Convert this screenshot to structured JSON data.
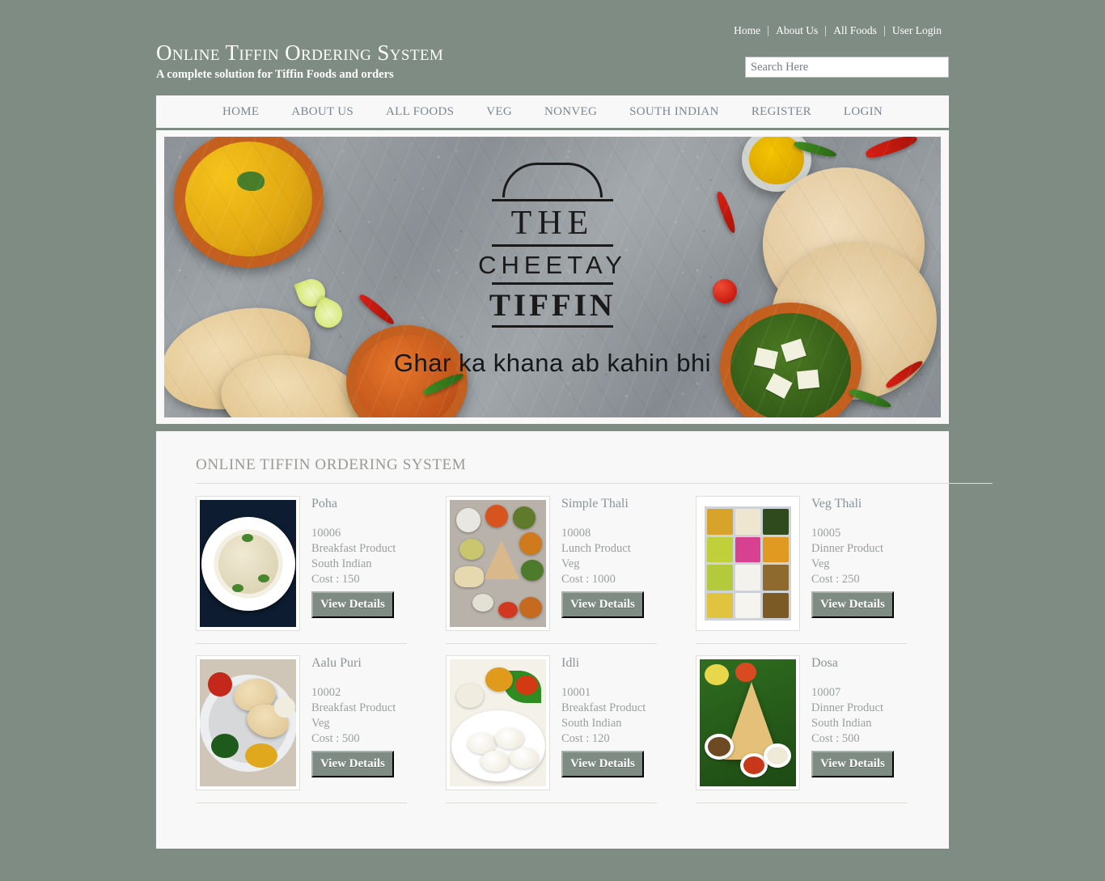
{
  "top_nav": {
    "items": [
      {
        "label": "Home"
      },
      {
        "label": "About Us"
      },
      {
        "label": "All Foods"
      },
      {
        "label": "User Login"
      }
    ]
  },
  "brand": {
    "title": "Online Tiffin Ordering System",
    "subtitle": "A complete solution for Tiffin Foods and orders"
  },
  "search": {
    "placeholder": "Search Here",
    "value": ""
  },
  "main_nav": {
    "items": [
      {
        "label": "HOME"
      },
      {
        "label": "ABOUT US"
      },
      {
        "label": "ALL FOODS"
      },
      {
        "label": "VEG"
      },
      {
        "label": "NONVEG"
      },
      {
        "label": "SOUTH INDIAN"
      },
      {
        "label": "REGISTER"
      },
      {
        "label": "LOGIN"
      }
    ]
  },
  "banner": {
    "logo_line1": "THE",
    "logo_line2": "CHEETAY",
    "logo_line3": "TIFFIN",
    "tagline": "Ghar ka khana ab kahin bhi"
  },
  "main": {
    "section_title": "ONLINE TIFFIN ORDERING SYSTEM",
    "button_label": "View Details",
    "products": [
      {
        "name": "Poha",
        "code": "10006",
        "meal": "Breakfast Product",
        "category": "South Indian",
        "cost": "Cost : 150",
        "button": "View Details"
      },
      {
        "name": "Simple Thali",
        "code": "10008",
        "meal": "Lunch Product",
        "category": "Veg",
        "cost": "Cost : 1000",
        "button": "View Details"
      },
      {
        "name": "Veg Thali",
        "code": "10005",
        "meal": "Dinner Product",
        "category": "Veg",
        "cost": "Cost : 250",
        "button": "View Details"
      },
      {
        "name": "Aalu Puri",
        "code": "10002",
        "meal": "Breakfast Product",
        "category": "Veg",
        "cost": "Cost : 500",
        "button": "View Details"
      },
      {
        "name": "Idli",
        "code": "10001",
        "meal": "Breakfast Product",
        "category": "South Indian",
        "cost": "Cost : 120",
        "button": "View Details"
      },
      {
        "name": "Dosa",
        "code": "10007",
        "meal": "Dinner Product",
        "category": "South Indian",
        "cost": "Cost : 500",
        "button": "View Details"
      }
    ]
  },
  "colors": {
    "page_background": "#7f8c83",
    "panel_background": "#f7f8f7",
    "accent_button": "#7f8c83",
    "muted_text": "#9a9f9d",
    "heading_text": "#9a9a95",
    "nav_text": "#7b8793"
  }
}
